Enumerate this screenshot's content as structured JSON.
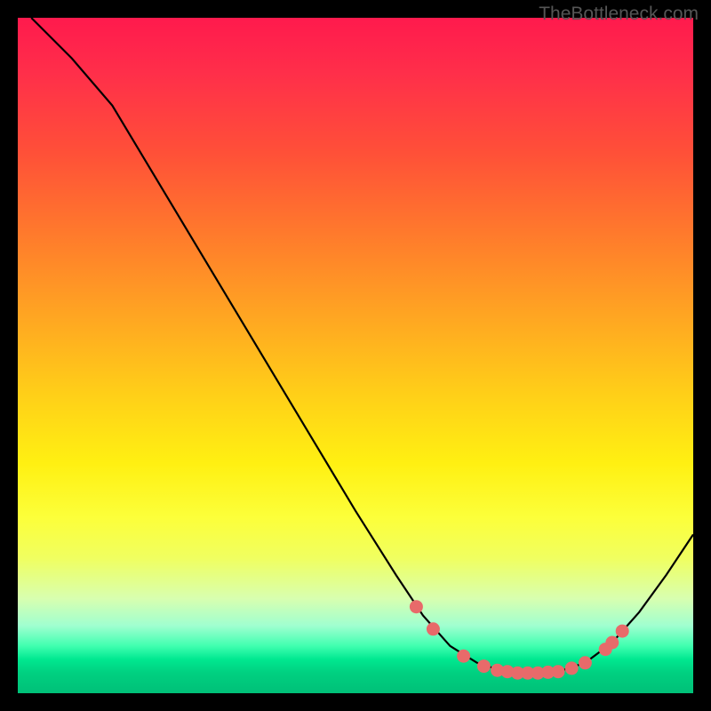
{
  "watermark": "TheBottleneck.com",
  "chart_data": {
    "type": "line",
    "title": "",
    "xlabel": "",
    "ylabel": "",
    "xlim": [
      0,
      1
    ],
    "ylim": [
      0,
      1
    ],
    "curve": [
      {
        "x": 0.02,
        "y": 1.0
      },
      {
        "x": 0.08,
        "y": 0.94
      },
      {
        "x": 0.14,
        "y": 0.87
      },
      {
        "x": 0.2,
        "y": 0.77
      },
      {
        "x": 0.26,
        "y": 0.67
      },
      {
        "x": 0.32,
        "y": 0.57
      },
      {
        "x": 0.38,
        "y": 0.47
      },
      {
        "x": 0.44,
        "y": 0.37
      },
      {
        "x": 0.5,
        "y": 0.27
      },
      {
        "x": 0.56,
        "y": 0.175
      },
      {
        "x": 0.6,
        "y": 0.115
      },
      {
        "x": 0.64,
        "y": 0.07
      },
      {
        "x": 0.68,
        "y": 0.045
      },
      {
        "x": 0.72,
        "y": 0.032
      },
      {
        "x": 0.76,
        "y": 0.03
      },
      {
        "x": 0.8,
        "y": 0.032
      },
      {
        "x": 0.84,
        "y": 0.045
      },
      {
        "x": 0.88,
        "y": 0.075
      },
      {
        "x": 0.92,
        "y": 0.12
      },
      {
        "x": 0.96,
        "y": 0.175
      },
      {
        "x": 1.0,
        "y": 0.235
      }
    ],
    "markers": [
      {
        "x": 0.59,
        "y": 0.128
      },
      {
        "x": 0.615,
        "y": 0.095
      },
      {
        "x": 0.66,
        "y": 0.055
      },
      {
        "x": 0.69,
        "y": 0.04
      },
      {
        "x": 0.71,
        "y": 0.034
      },
      {
        "x": 0.725,
        "y": 0.032
      },
      {
        "x": 0.74,
        "y": 0.03
      },
      {
        "x": 0.755,
        "y": 0.03
      },
      {
        "x": 0.77,
        "y": 0.03
      },
      {
        "x": 0.785,
        "y": 0.031
      },
      {
        "x": 0.8,
        "y": 0.032
      },
      {
        "x": 0.82,
        "y": 0.037
      },
      {
        "x": 0.84,
        "y": 0.045
      },
      {
        "x": 0.87,
        "y": 0.065
      },
      {
        "x": 0.88,
        "y": 0.075
      },
      {
        "x": 0.895,
        "y": 0.092
      }
    ],
    "gradient_stops": [
      {
        "pos": 0.0,
        "color": "#ff1a4d"
      },
      {
        "pos": 0.5,
        "color": "#ffd018"
      },
      {
        "pos": 0.8,
        "color": "#f0ff60"
      },
      {
        "pos": 0.93,
        "color": "#40ffb0"
      },
      {
        "pos": 1.0,
        "color": "#00c078"
      }
    ]
  }
}
